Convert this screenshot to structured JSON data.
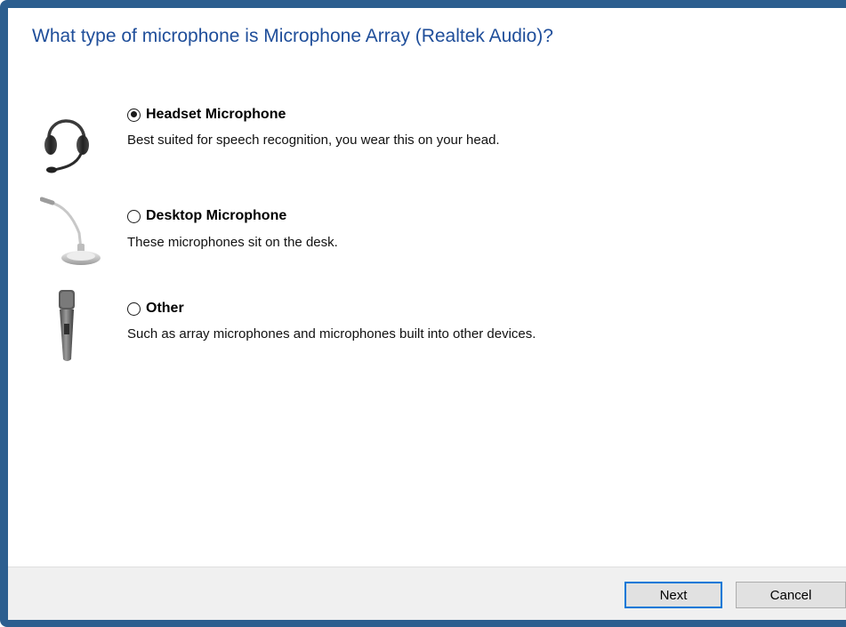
{
  "dialog": {
    "heading": "What type of microphone is Microphone Array (Realtek Audio)?"
  },
  "options": [
    {
      "label": "Headset Microphone",
      "description": "Best suited for speech recognition, you wear this on your head.",
      "selected": true,
      "icon": "headset-icon"
    },
    {
      "label": "Desktop Microphone",
      "description": "These microphones sit on the desk.",
      "selected": false,
      "icon": "desktop-microphone-icon"
    },
    {
      "label": "Other",
      "description": "Such as array microphones and microphones built into other devices.",
      "selected": false,
      "icon": "handheld-microphone-icon"
    }
  ],
  "footer": {
    "next_label": "Next",
    "cancel_label": "Cancel"
  },
  "colors": {
    "heading": "#1f4e9a",
    "frame": "#2c5e8f",
    "default_button_border": "#0078d7"
  }
}
